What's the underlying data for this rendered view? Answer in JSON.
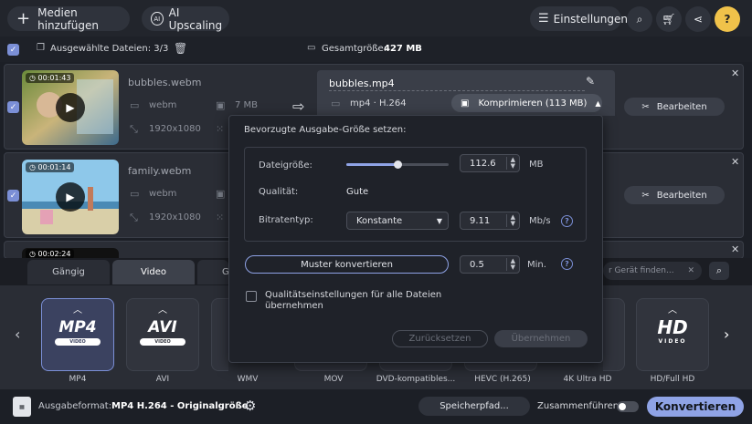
{
  "toolbar": {
    "add_media_label": "Medien hinzufügen",
    "ai_upscaling_label": "AI Upscaling",
    "settings_label": "Einstellungen"
  },
  "selection": {
    "selected_label": "Ausgewählte Dateien: 3/3",
    "total_size_label": "Gesamtgröße:",
    "total_size_value": "427 MB"
  },
  "files": [
    {
      "duration": "00:01:43",
      "name": "bubbles.webm",
      "format": "webm",
      "size": "7 MB",
      "resolution": "1920x1080"
    },
    {
      "duration": "00:01:14",
      "name": "family.webm",
      "format": "webm",
      "resolution": "1920x1080"
    },
    {
      "duration": "00:02:24"
    }
  ],
  "output": {
    "name": "bubbles.mp4",
    "format": "mp4 · H.264",
    "compress_label": "Komprimieren (113 MB)"
  },
  "edit_label": "Bearbeiten",
  "dialog": {
    "title": "Bevorzugte Ausgabe-Größe setzen:",
    "filesize_label": "Dateigröße:",
    "filesize_value": "112.6",
    "filesize_unit": "MB",
    "filesize_fraction": 0.5,
    "quality_label": "Qualität:",
    "quality_value": "Gute",
    "bitrate_label": "Bitratentyp:",
    "bitrate_type": "Konstante",
    "bitrate_value": "9.11",
    "bitrate_unit": "Mb/s",
    "sample_button": "Muster konvertieren",
    "sample_value": "0.5",
    "sample_unit": "Min.",
    "apply_all_label": "Qualitätseinstellungen für alle Dateien übernehmen",
    "reset_button": "Zurücksetzen",
    "apply_button": "Übernehmen"
  },
  "tabs": [
    "Gängig",
    "Video",
    "G"
  ],
  "device_search_placeholder": "r Gerät finden...",
  "formats": [
    {
      "logo": "MP4",
      "sub": "VIDEO",
      "label": "MP4"
    },
    {
      "logo": "AVI",
      "sub": "VIDEO",
      "label": "AVI"
    },
    {
      "label": "WMV"
    },
    {
      "label": "MOV"
    },
    {
      "label": "DVD-kompatibles..."
    },
    {
      "label": "HEVC (H.265)"
    },
    {
      "label": "4K Ultra HD"
    },
    {
      "logo": "HD",
      "sub": "VIDEO",
      "label": "HD/Full HD"
    }
  ],
  "bottom": {
    "format_prefix": "Ausgabeformat:",
    "format_value": "MP4 H.264 - Originalgröße",
    "save_path_label": "Speicherpfad...",
    "merge_label": "Zusammenführen:",
    "convert_label": "Konvertieren"
  },
  "colors": {
    "accent": "#7b8fd6",
    "background": "#1c1f26"
  }
}
